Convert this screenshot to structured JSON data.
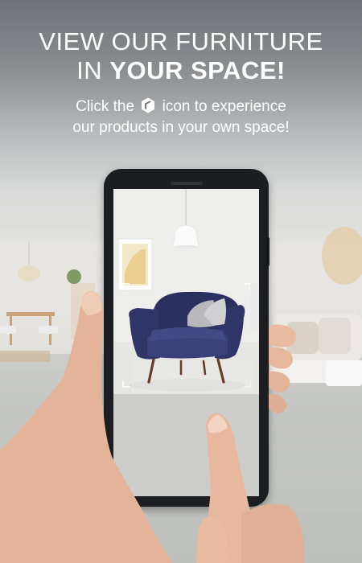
{
  "headline": {
    "line1": "VIEW OUR FURNITURE",
    "line2_prefix": "IN ",
    "line2_bold": "YOUR SPACE!"
  },
  "subtitle": {
    "part1": "Click the",
    "icon": "ar-cube-icon",
    "part2": "icon to experience",
    "line2": "our products in your own space!"
  },
  "colors": {
    "headline_text": "#ffffff",
    "chair_fabric": "#2f3566",
    "phone_body": "#1c1d20"
  }
}
